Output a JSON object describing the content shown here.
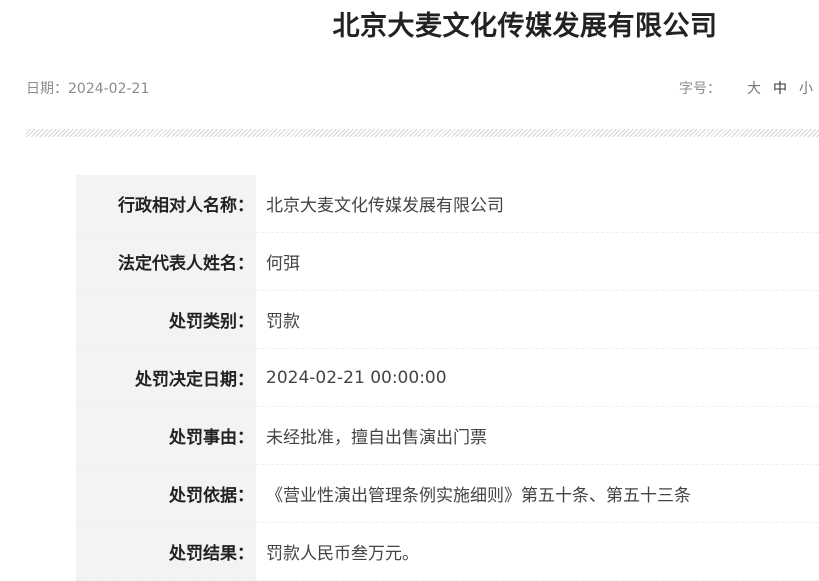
{
  "header": {
    "title": "北京大麦文化传媒发展有限公司"
  },
  "meta": {
    "date_text": "日期：2024-02-21",
    "fontsize_label": "字号：",
    "fontsize_options": [
      "大",
      "中",
      "小"
    ]
  },
  "rows": [
    {
      "label": "行政相对人名称：",
      "value": "北京大麦文化传媒发展有限公司"
    },
    {
      "label": "法定代表人姓名：",
      "value": "何弭"
    },
    {
      "label": "处罚类别：",
      "value": "罚款"
    },
    {
      "label": "处罚决定日期：",
      "value": "2024-02-21 00:00:00"
    },
    {
      "label": "处罚事由：",
      "value": "未经批准，擅自出售演出门票"
    },
    {
      "label": "处罚依据：",
      "value": "《营业性演出管理条例实施细则》第五十条、第五十三条"
    },
    {
      "label": "处罚结果：",
      "value": "罚款人民币叁万元。"
    }
  ]
}
